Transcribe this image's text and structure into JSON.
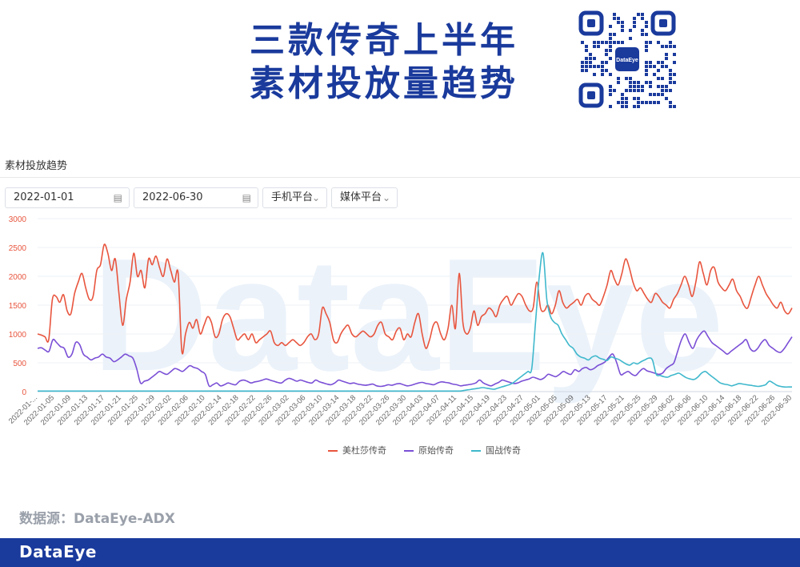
{
  "header": {
    "title_line1": "三款传奇上半年",
    "title_line2": "素材投放量趋势"
  },
  "qr_badge": {
    "text": "DataEye"
  },
  "panel": {
    "title": "素材投放趋势"
  },
  "controls": {
    "start_date": "2022-01-01",
    "end_date": "2022-06-30",
    "platform_filter": "手机平台",
    "media_filter": "媒体平台"
  },
  "watermark": "DataEye",
  "source": "数据源：DataEye-ADX",
  "footer": {
    "logo": "DataEye"
  },
  "colors": {
    "title": "#1a3a9c",
    "footer": "#1a3a9c",
    "series1": "#e8553e",
    "series2": "#7a4fd6",
    "series3": "#3fb8cc"
  },
  "chart_data": {
    "type": "line",
    "ylim": [
      0,
      3000
    ],
    "yticks": [
      0,
      500,
      1000,
      1500,
      2000,
      2500,
      3000
    ],
    "x_start": "2022-01-01",
    "x_end": "2022-06-30",
    "xtick_labels": [
      "2022-01-...",
      "2022-01-05",
      "2022-01-09",
      "2022-01-13",
      "2022-01-17",
      "2022-01-21",
      "2022-01-25",
      "2022-01-29",
      "2022-02-02",
      "2022-02-06",
      "2022-02-10",
      "2022-02-14",
      "2022-02-18",
      "2022-02-22",
      "2022-02-26",
      "2022-03-02",
      "2022-03-06",
      "2022-03-10",
      "2022-03-14",
      "2022-03-18",
      "2022-03-22",
      "2022-03-26",
      "2022-03-30",
      "2022-04-03",
      "2022-04-07",
      "2022-04-11",
      "2022-04-15",
      "2022-04-19",
      "2022-04-23",
      "2022-04-27",
      "2022-05-01",
      "2022-05-05",
      "2022-05-09",
      "2022-05-13",
      "2022-05-17",
      "2022-05-21",
      "2022-05-25",
      "2022-05-29",
      "2022-06-02",
      "2022-06-06",
      "2022-06-10",
      "2022-06-14",
      "2022-06-18",
      "2022-06-22",
      "2022-06-26",
      "2022-06-30"
    ],
    "legend_position": "bottom",
    "series": [
      {
        "name": "美杜莎传奇",
        "color": "#e8553e",
        "values": [
          1000,
          980,
          950,
          900,
          1600,
          1650,
          1550,
          1680,
          1400,
          1350,
          1700,
          1900,
          2050,
          1800,
          1600,
          1650,
          2100,
          2200,
          2550,
          2400,
          2100,
          2300,
          1700,
          1150,
          1600,
          1900,
          2400,
          2000,
          2100,
          1800,
          2300,
          2200,
          2350,
          2150,
          2000,
          2300,
          2100,
          1900,
          2050,
          700,
          1000,
          1200,
          1100,
          1250,
          1000,
          1150,
          1300,
          1200,
          950,
          1000,
          1250,
          1350,
          1300,
          1100,
          900,
          950,
          1000,
          900,
          1000,
          850,
          900,
          950,
          1000,
          1050,
          850,
          800,
          850,
          800,
          850,
          900,
          850,
          800,
          850,
          950,
          1000,
          900,
          1000,
          1450,
          1350,
          1200,
          900,
          850,
          1000,
          1100,
          1150,
          1000,
          950,
          1000,
          1050,
          1000,
          950,
          1000,
          1150,
          1200,
          1000,
          950,
          900,
          1050,
          1100,
          900,
          1000,
          950,
          1200,
          1350,
          1000,
          750,
          900,
          1150,
          1200,
          1000,
          900,
          1100,
          1500,
          1100,
          2050,
          1200,
          1000,
          1100,
          1400,
          1150,
          1300,
          1350,
          1450,
          1400,
          1300,
          1500,
          1600,
          1650,
          1500,
          1600,
          1700,
          1650,
          1500,
          1400,
          1450,
          1900,
          1450,
          1400,
          1500,
          1350,
          1500,
          1750,
          1550,
          1450,
          1500,
          1550,
          1600,
          1500,
          1650,
          1700,
          1600,
          1550,
          1500,
          1650,
          1850,
          2100,
          1950,
          1850,
          2050,
          2300,
          2150,
          1900,
          1750,
          1800,
          1700,
          1600,
          1550,
          1700,
          1650,
          1550,
          1500,
          1450,
          1600,
          1700,
          1850,
          2000,
          1850,
          1650,
          1900,
          2250,
          2050,
          1850,
          2100,
          2150,
          1900,
          1800,
          1750,
          1850,
          1950,
          1750,
          1650,
          1500,
          1450,
          1650,
          1850,
          2000,
          1850,
          1700,
          1600,
          1500,
          1450,
          1550,
          1400,
          1350,
          1450
        ]
      },
      {
        "name": "原始传奇",
        "color": "#7a4fd6",
        "values": [
          750,
          760,
          720,
          700,
          900,
          850,
          780,
          750,
          600,
          650,
          850,
          820,
          650,
          600,
          550,
          580,
          600,
          650,
          600,
          580,
          520,
          550,
          600,
          650,
          620,
          580,
          400,
          150,
          180,
          200,
          250,
          300,
          350,
          320,
          300,
          350,
          400,
          380,
          350,
          400,
          450,
          420,
          400,
          350,
          300,
          100,
          120,
          150,
          100,
          120,
          150,
          130,
          120,
          180,
          200,
          180,
          150,
          170,
          180,
          200,
          220,
          200,
          180,
          160,
          150,
          200,
          230,
          210,
          180,
          200,
          180,
          160,
          150,
          200,
          170,
          150,
          130,
          120,
          150,
          200,
          180,
          160,
          140,
          150,
          130,
          120,
          110,
          120,
          130,
          100,
          90,
          100,
          120,
          110,
          130,
          140,
          120,
          100,
          110,
          130,
          150,
          160,
          140,
          130,
          120,
          150,
          170,
          160,
          150,
          130,
          120,
          100,
          110,
          120,
          130,
          150,
          200,
          150,
          120,
          100,
          130,
          160,
          200,
          180,
          160,
          140,
          150,
          180,
          200,
          220,
          250,
          230,
          210,
          240,
          300,
          280,
          260,
          300,
          350,
          320,
          300,
          380,
          350,
          400,
          420,
          380,
          400,
          450,
          480,
          520,
          600,
          650,
          500,
          300,
          320,
          350,
          300,
          280,
          350,
          400,
          360,
          340,
          320,
          300,
          320,
          400,
          450,
          500,
          700,
          900,
          1000,
          850,
          750,
          900,
          1000,
          1050,
          950,
          850,
          800,
          750,
          700,
          650,
          700,
          750,
          800,
          850,
          900,
          750,
          700,
          750,
          850,
          900,
          800,
          750,
          700,
          680,
          750,
          850,
          950
        ]
      },
      {
        "name": "国战传奇",
        "color": "#3fb8cc",
        "values": [
          10,
          10,
          10,
          10,
          10,
          10,
          10,
          10,
          10,
          10,
          10,
          10,
          10,
          10,
          10,
          10,
          10,
          10,
          10,
          10,
          10,
          10,
          10,
          10,
          10,
          10,
          10,
          10,
          10,
          10,
          10,
          10,
          10,
          10,
          10,
          10,
          10,
          10,
          10,
          10,
          10,
          10,
          10,
          10,
          10,
          10,
          10,
          10,
          10,
          10,
          10,
          10,
          10,
          10,
          10,
          10,
          10,
          10,
          10,
          10,
          10,
          10,
          10,
          10,
          10,
          10,
          10,
          10,
          10,
          10,
          10,
          10,
          10,
          10,
          10,
          10,
          10,
          10,
          10,
          10,
          10,
          10,
          10,
          10,
          10,
          10,
          10,
          10,
          10,
          10,
          10,
          10,
          10,
          10,
          10,
          10,
          10,
          10,
          10,
          10,
          10,
          10,
          10,
          10,
          10,
          10,
          10,
          10,
          10,
          10,
          10,
          10,
          10,
          20,
          30,
          40,
          50,
          60,
          70,
          60,
          50,
          40,
          60,
          80,
          100,
          120,
          150,
          200,
          250,
          300,
          350,
          400,
          1200,
          2000,
          2400,
          1600,
          1300,
          1200,
          1150,
          1000,
          900,
          800,
          750,
          650,
          600,
          580,
          550,
          600,
          620,
          580,
          560,
          540,
          600,
          580,
          560,
          520,
          480,
          460,
          500,
          480,
          520,
          550,
          580,
          550,
          300,
          280,
          260,
          250,
          280,
          300,
          320,
          280,
          240,
          220,
          210,
          250,
          320,
          350,
          300,
          250,
          200,
          150,
          130,
          120,
          100,
          120,
          140,
          130,
          120,
          110,
          100,
          90,
          100,
          120,
          180,
          150,
          110,
          90,
          80,
          80,
          80
        ]
      }
    ]
  }
}
